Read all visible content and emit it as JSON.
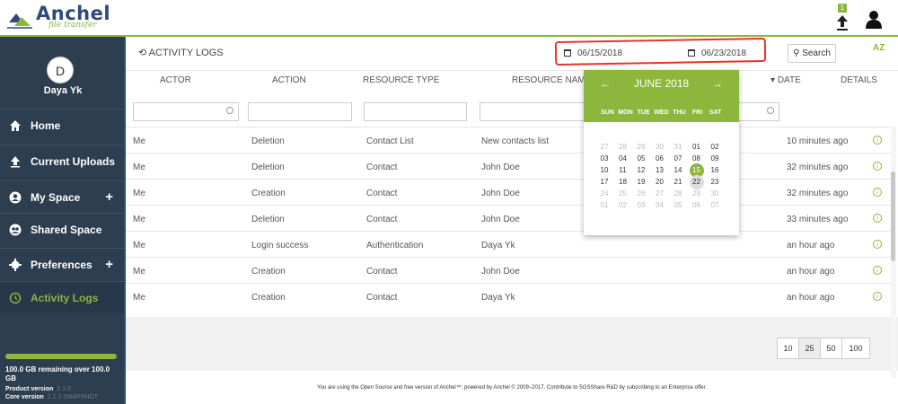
{
  "app": {
    "name": "Anchel",
    "subtitle": "file transfer",
    "upload_badge": "1"
  },
  "user": {
    "initial": "D",
    "name": "Daya Yk"
  },
  "sidebar": {
    "items": [
      {
        "label": "Home",
        "icon": "home-icon",
        "plus": ""
      },
      {
        "label": "Current Uploads",
        "icon": "upload-icon",
        "plus": ""
      },
      {
        "label": "My Space",
        "icon": "user-circle-icon",
        "plus": "+"
      },
      {
        "label": "Shared Space",
        "icon": "users-circle-icon",
        "plus": ""
      },
      {
        "label": "Preferences",
        "icon": "gear-icon",
        "plus": "+"
      },
      {
        "label": "Activity Logs",
        "icon": "history-icon",
        "plus": ""
      }
    ],
    "storage_text": "100.0 GB remaining over 100.0 GB",
    "product_version_label": "Product version",
    "product_version": "2.1.0",
    "core_version_label": "Core version",
    "core_version": "2.1.1-SNAPSHOT"
  },
  "header": {
    "title": "ACTIVITY LOGS",
    "date_from": "06/15/2018",
    "date_to": "06/23/2018",
    "search_label": "Search",
    "sort_label": "AZ"
  },
  "columns": [
    "ACTOR",
    "ACTION",
    "RESOURCE TYPE",
    "RESOURCE NAME",
    "DATE",
    "DETAILS"
  ],
  "rows": [
    {
      "actor": "Me",
      "action": "Deletion",
      "resource_type": "Contact List",
      "resource_name": "New contacts list",
      "date": "10 minutes ago"
    },
    {
      "actor": "Me",
      "action": "Deletion",
      "resource_type": "Contact",
      "resource_name": "John Doe",
      "date": "32 minutes ago"
    },
    {
      "actor": "Me",
      "action": "Creation",
      "resource_type": "Contact",
      "resource_name": "John Doe",
      "date": "32 minutes ago"
    },
    {
      "actor": "Me",
      "action": "Deletion",
      "resource_type": "Contact",
      "resource_name": "John Doe",
      "date": "33 minutes ago"
    },
    {
      "actor": "Me",
      "action": "Login success",
      "resource_type": "Authentication",
      "resource_name": "Daya Yk",
      "date": "an hour ago"
    },
    {
      "actor": "Me",
      "action": "Creation",
      "resource_type": "Contact",
      "resource_name": "John Doe",
      "date": "an hour ago"
    },
    {
      "actor": "Me",
      "action": "Creation",
      "resource_type": "Contact",
      "resource_name": "Daya Yk",
      "date": "an hour ago"
    }
  ],
  "pager": {
    "options": [
      "10",
      "25",
      "50",
      "100"
    ],
    "selected": "25"
  },
  "calendar": {
    "month_label": "JUNE 2018",
    "prev": "←",
    "next": "→",
    "weekdays": [
      "SUN",
      "MON",
      "TUE",
      "WED",
      "THU",
      "FRI",
      "SAT"
    ],
    "weeks": [
      [
        "27",
        "28",
        "29",
        "30",
        "31",
        "01",
        "02"
      ],
      [
        "03",
        "04",
        "05",
        "06",
        "07",
        "08",
        "09"
      ],
      [
        "10",
        "11",
        "12",
        "13",
        "14",
        "15",
        "16"
      ],
      [
        "17",
        "18",
        "19",
        "20",
        "21",
        "22",
        "23"
      ],
      [
        "24",
        "25",
        "26",
        "27",
        "28",
        "29",
        "30"
      ],
      [
        "01",
        "02",
        "03",
        "04",
        "05",
        "06",
        "07"
      ]
    ],
    "selected_day": "15",
    "highlight_day": "22"
  },
  "footer": "You are using the Open Source and free version of Anchel™, powered by Anchel © 2009–2017. Contribute to SGSShare R&D by subscribing to an Enterprise offer.",
  "colors": {
    "accent": "#8db63c",
    "sidebar": "#2d3e50",
    "annotation": "#e8322e"
  }
}
